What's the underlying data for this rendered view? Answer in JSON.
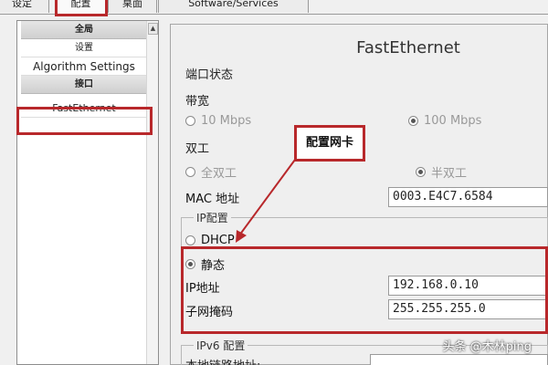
{
  "tabs": [
    {
      "label": "设定"
    },
    {
      "label": "配置"
    },
    {
      "label": "桌面"
    },
    {
      "label": "Software/Services"
    }
  ],
  "sidebar": {
    "global_header": "全局",
    "global_item": "设置",
    "algorithm_item": "Algorithm Settings",
    "interface_header": "接口",
    "interface_item": "FastEthernet"
  },
  "panel": {
    "title": "FastEthernet",
    "port_status_label": "端口状态",
    "bandwidth_label": "带宽",
    "bandwidth_10": "10 Mbps",
    "bandwidth_100": "100 Mbps",
    "duplex_label": "双工",
    "full_duplex": "全双工",
    "half_duplex": "半双工",
    "mac_label": "MAC 地址",
    "mac_value": "0003.E4C7.6584",
    "ip_config_label": "IP配置",
    "dhcp_label": "DHCP",
    "static_label": "静态",
    "ip_label": "IP地址",
    "ip_value": "192.168.0.10",
    "subnet_label": "子网掩码",
    "subnet_value": "255.255.255.0",
    "ipv6_config_label": "IPv6 配置",
    "link_local_label": "本地链路地址:"
  },
  "annotation": {
    "callout_text": "配置网卡"
  },
  "watermark": "头条 @木林ping",
  "colors": {
    "highlight_red": "#b8282b",
    "panel_bg": "#efefef"
  }
}
